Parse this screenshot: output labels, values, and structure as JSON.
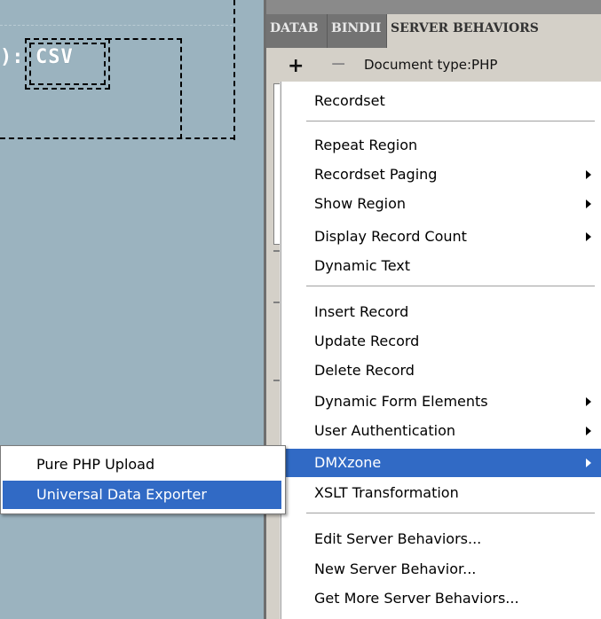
{
  "canvas": {
    "colon": "):",
    "csv_label": "CSV"
  },
  "panel": {
    "tabs": [
      "DATAB",
      "BINDII",
      "SERVER BEHAVIORS"
    ],
    "toolbar": {
      "add": "+",
      "remove": "−",
      "document_type": "Document type:PHP"
    }
  },
  "menu": {
    "items": [
      {
        "label": "Recordset",
        "submenu": false
      },
      {
        "label": "Repeat Region",
        "submenu": false
      },
      {
        "label": "Recordset Paging",
        "submenu": true
      },
      {
        "label": "Show Region",
        "submenu": true
      },
      {
        "label": "Display Record Count",
        "submenu": true
      },
      {
        "label": "Dynamic Text",
        "submenu": false
      },
      {
        "label": "Insert Record",
        "submenu": false
      },
      {
        "label": "Update Record",
        "submenu": false
      },
      {
        "label": "Delete Record",
        "submenu": false
      },
      {
        "label": "Dynamic Form Elements",
        "submenu": true
      },
      {
        "label": "User Authentication",
        "submenu": true
      },
      {
        "label": "DMXzone",
        "submenu": true,
        "highlighted": true
      },
      {
        "label": "XSLT Transformation",
        "submenu": false
      },
      {
        "label": "Edit Server Behaviors...",
        "submenu": false
      },
      {
        "label": "New Server Behavior...",
        "submenu": false
      },
      {
        "label": "Get More Server Behaviors...",
        "submenu": false
      }
    ]
  },
  "submenu": {
    "items": [
      {
        "label": "Pure PHP Upload"
      },
      {
        "label": "Universal Data Exporter",
        "highlighted": true
      }
    ]
  },
  "colors": {
    "highlight": "#316ac5",
    "canvas_bg": "#9bb3bf",
    "panel_bg": "#d4d0c8"
  }
}
